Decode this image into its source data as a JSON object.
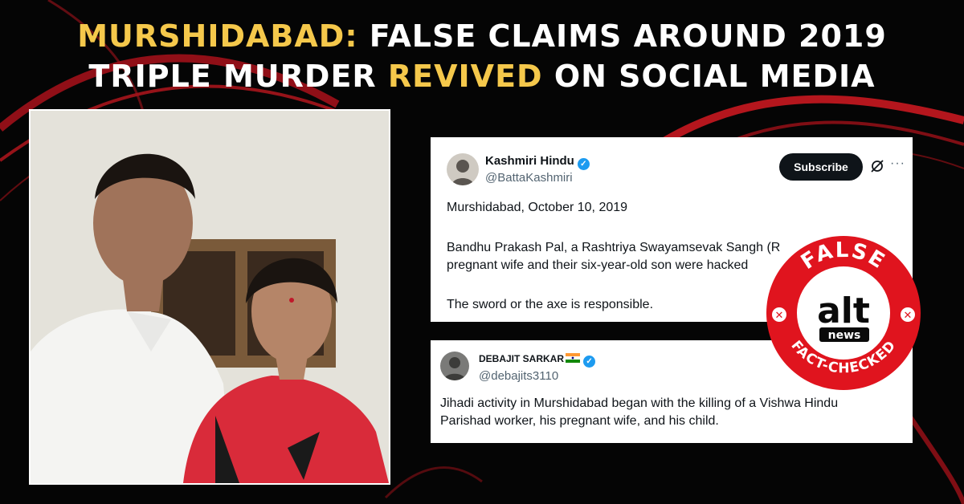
{
  "headline": {
    "line1_highlight": "MURSHIDABAD:",
    "line1_rest": "FALSE CLAIMS AROUND 2019",
    "line2_start": "TRIPLE MURDER",
    "line2_highlight": "REVIVED",
    "line2_end": "ON SOCIAL MEDIA"
  },
  "tweet1": {
    "name": "Kashmiri Hindu",
    "handle": "@BattaKashmiri",
    "subscribe_label": "Subscribe",
    "more_label": "···",
    "line1": "Murshidabad, October 10, 2019",
    "line2": "Bandhu Prakash Pal, a Rashtriya Swayamsevak Sangh (R",
    "line3": "pregnant wife and their six-year-old son were hacked",
    "line4": "The sword or the axe is responsible."
  },
  "tweet2": {
    "name": "DEBAJIT SARKAR",
    "handle": "@debajits3110",
    "text": "Jihadi activity in Murshidabad began with the killing of a Vishwa Hindu\nParishad worker, his pregnant wife, and his child."
  },
  "stamp": {
    "top_text": "FALSE",
    "logo_text": "alt",
    "logo_sub": "news",
    "bottom_text": "FACT-CHECKED"
  },
  "colors": {
    "accent_yellow": "#f5c84b",
    "stamp_red": "#e0141e",
    "verified_blue": "#1d9bf0"
  }
}
